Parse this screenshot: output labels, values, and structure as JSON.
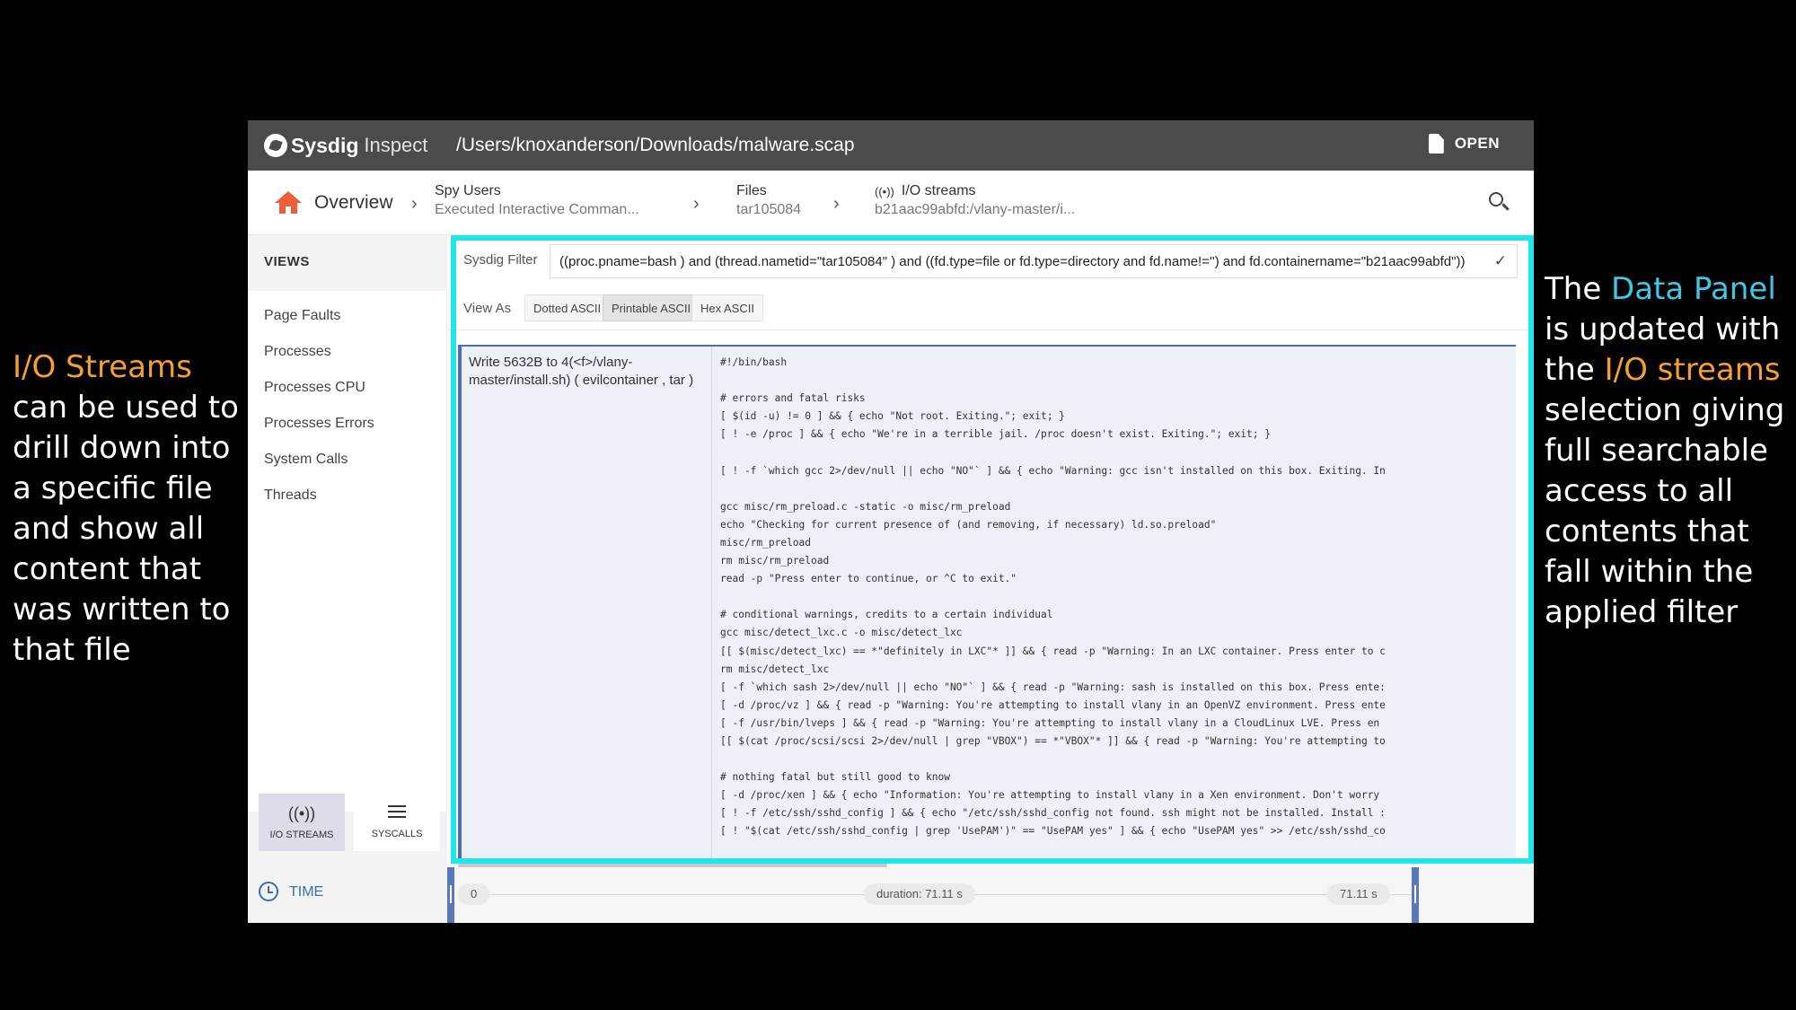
{
  "annotations": {
    "left": {
      "highlight": "I/O Streams",
      "rest": " can be used to drill down into a specific file and show all content that was written to that file"
    },
    "right": {
      "part1": "The ",
      "highlight1": "Data Panel",
      "part2": " is updated with the ",
      "highlight2": "I/O streams",
      "part3": " selection giving full searchable access to all contents that fall within the applied filter"
    },
    "colors": {
      "orange": "#f5a030",
      "blue": "#3ec7e6",
      "panel_outline": "#20e6ea",
      "io_button_outline": "#f39a2b"
    }
  },
  "app": {
    "name": "Sysdig",
    "name_suffix": "Inspect",
    "file_path": "/Users/knoxanderson/Downloads/malware.scap",
    "open_label": "OPEN",
    "open_icon": "document-icon"
  },
  "breadcrumb": {
    "home_label": "Overview",
    "home_icon": "home-icon",
    "items": [
      {
        "title": "Spy Users",
        "subtitle": "Executed Interactive Comman..."
      },
      {
        "title": "Files",
        "subtitle": "tar105084"
      },
      {
        "title": "I/O streams",
        "subtitle": "b21aac99abfd:/vlany-master/i...",
        "icon": "io-streams-icon"
      }
    ]
  },
  "sidebar": {
    "views_title": "VIEWS",
    "views": [
      "Page Faults",
      "Processes",
      "Processes CPU",
      "Processes Errors",
      "System Calls",
      "Threads"
    ],
    "modes": [
      {
        "label": "I/O STREAMS",
        "icon": "io-streams-icon",
        "active": true
      },
      {
        "label": "SYSCALLS",
        "icon": "lines-icon",
        "active": false
      }
    ],
    "time_label": "TIME"
  },
  "panel": {
    "filter_label": "Sysdig Filter",
    "filter_value": "((proc.pname=bash ) and (thread.nametid=\"tar105084\" ) and ((fd.type=file or fd.type=directory and fd.name!='') and fd.containername=\"b21aac99abfd\"))",
    "view_as_label": "View As",
    "view_as_options": [
      "Dotted ASCII",
      "Printable ASCII",
      "Hex ASCII"
    ],
    "view_as_selected": "Printable ASCII",
    "stream": {
      "description": "Write 5632B to 4(<f>/vlany-master/install.sh) ( evilcontainer , tar )",
      "lines": [
        "#!/bin/bash",
        "",
        "# errors and fatal risks",
        "[ $(id -u) != 0 ] && { echo \"Not root. Exiting.\"; exit; }",
        "[ ! -e /proc ] && { echo \"We're in a terrible jail. /proc doesn't exist. Exiting.\"; exit; }",
        "",
        "[ ! -f `which gcc 2>/dev/null || echo \"NO\"` ] && { echo \"Warning: gcc isn't installed on this box. Exiting. In",
        "",
        "gcc misc/rm_preload.c -static -o misc/rm_preload",
        "echo \"Checking for current presence of (and removing, if necessary) ld.so.preload\"",
        "misc/rm_preload",
        "rm misc/rm_preload",
        "read -p \"Press enter to continue, or ^C to exit.\"",
        "",
        "# conditional warnings, credits to a certain individual",
        "gcc misc/detect_lxc.c -o misc/detect_lxc",
        "[[ $(misc/detect_lxc) == *\"definitely in LXC\"* ]] && { read -p \"Warning: In an LXC container. Press enter to c",
        "rm misc/detect_lxc",
        "[ -f `which sash 2>/dev/null || echo \"NO\"` ] && { read -p \"Warning: sash is installed on this box. Press ente:",
        "[ -d /proc/vz ] && { read -p \"Warning: You're attempting to install vlany in an OpenVZ environment. Press ente",
        "[ -f /usr/bin/lveps ] && { read -p \"Warning: You're attempting to install vlany in a CloudLinux LVE. Press en",
        "[[ $(cat /proc/scsi/scsi 2>/dev/null | grep \"VBOX\") == *\"VBOX\"* ]] && { read -p \"Warning: You're attempting to",
        "",
        "# nothing fatal but still good to know",
        "[ -d /proc/xen ] && { echo \"Information: You're attempting to install vlany in a Xen environment. Don't worry",
        "[ ! -f /etc/ssh/sshd_config ] && { echo \"/etc/ssh/sshd_config not found. ssh might not be installed. Install :",
        "[ ! \"$(cat /etc/ssh/sshd_config | grep 'UsePAM')\" == \"UsePAM yes\" ] && { echo \"UsePAM yes\" >> /etc/ssh/sshd_co"
      ]
    }
  },
  "timeline": {
    "start": "0",
    "duration": "duration: 71.11 s",
    "end": "71.11 s"
  }
}
